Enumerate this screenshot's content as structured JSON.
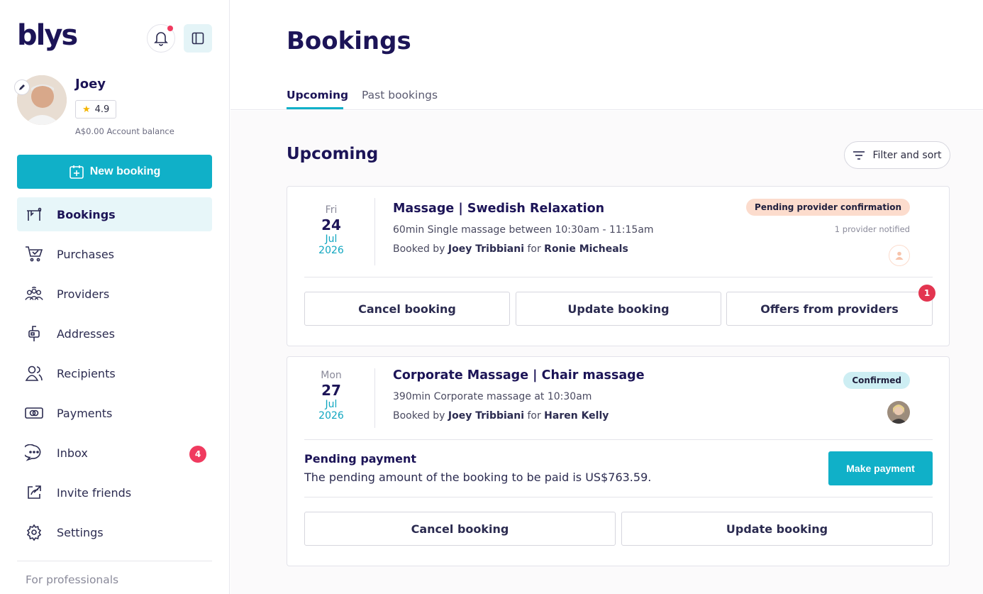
{
  "brand": {
    "logo_text": "blys",
    "accent": "#10b0c8",
    "navy": "#1c1457",
    "badge_red": "#f03a5f"
  },
  "user": {
    "name": "Joey",
    "rating": "4.9",
    "balance": "A$0.00",
    "balance_label": "Account balance"
  },
  "sidebar": {
    "new_booking_label": "New booking",
    "items": [
      {
        "label": "Bookings",
        "icon": "bookings-icon"
      },
      {
        "label": "Purchases",
        "icon": "cart-icon"
      },
      {
        "label": "Providers",
        "icon": "providers-icon"
      },
      {
        "label": "Addresses",
        "icon": "mailbox-icon"
      },
      {
        "label": "Recipients",
        "icon": "recipients-icon"
      },
      {
        "label": "Payments",
        "icon": "payments-icon"
      },
      {
        "label": "Inbox",
        "icon": "chat-icon",
        "badge": "4"
      },
      {
        "label": "Invite friends",
        "icon": "share-icon"
      },
      {
        "label": "Settings",
        "icon": "gear-icon"
      }
    ],
    "footer_label": "For professionals"
  },
  "main": {
    "title": "Bookings",
    "tabs": [
      {
        "label": "Upcoming",
        "active": true
      },
      {
        "label": "Past bookings",
        "active": false
      }
    ],
    "section_title": "Upcoming",
    "filter_label": "Filter and sort"
  },
  "bookings": [
    {
      "dow": "Fri",
      "day": "24",
      "month": "Jul",
      "year": "2026",
      "title": "Massage | Swedish Relaxation",
      "desc": "60min Single massage between 10:30am - 11:15am",
      "booked_by_prefix": "Booked by",
      "booked_by": "Joey Tribbiani",
      "for_word": "for",
      "recipient": "Ronie Micheals",
      "status": "Pending provider confirmation",
      "notified": "1 provider notified",
      "actions": [
        "Cancel booking",
        "Update booking",
        "Offers from providers"
      ],
      "offers_count": "1"
    },
    {
      "dow": "Mon",
      "day": "27",
      "month": "Jul",
      "year": "2026",
      "title": "Corporate Massage | Chair massage",
      "desc": "390min Corporate massage at 10:30am",
      "booked_by_prefix": "Booked by",
      "booked_by": "Joey Tribbiani",
      "for_word": "for",
      "recipient": "Haren Kelly",
      "status": "Confirmed",
      "pending_title": "Pending payment",
      "pending_text": "The pending amount of the booking to be paid is US$763.59.",
      "pay_label": "Make payment",
      "actions": [
        "Cancel booking",
        "Update booking"
      ]
    }
  ]
}
